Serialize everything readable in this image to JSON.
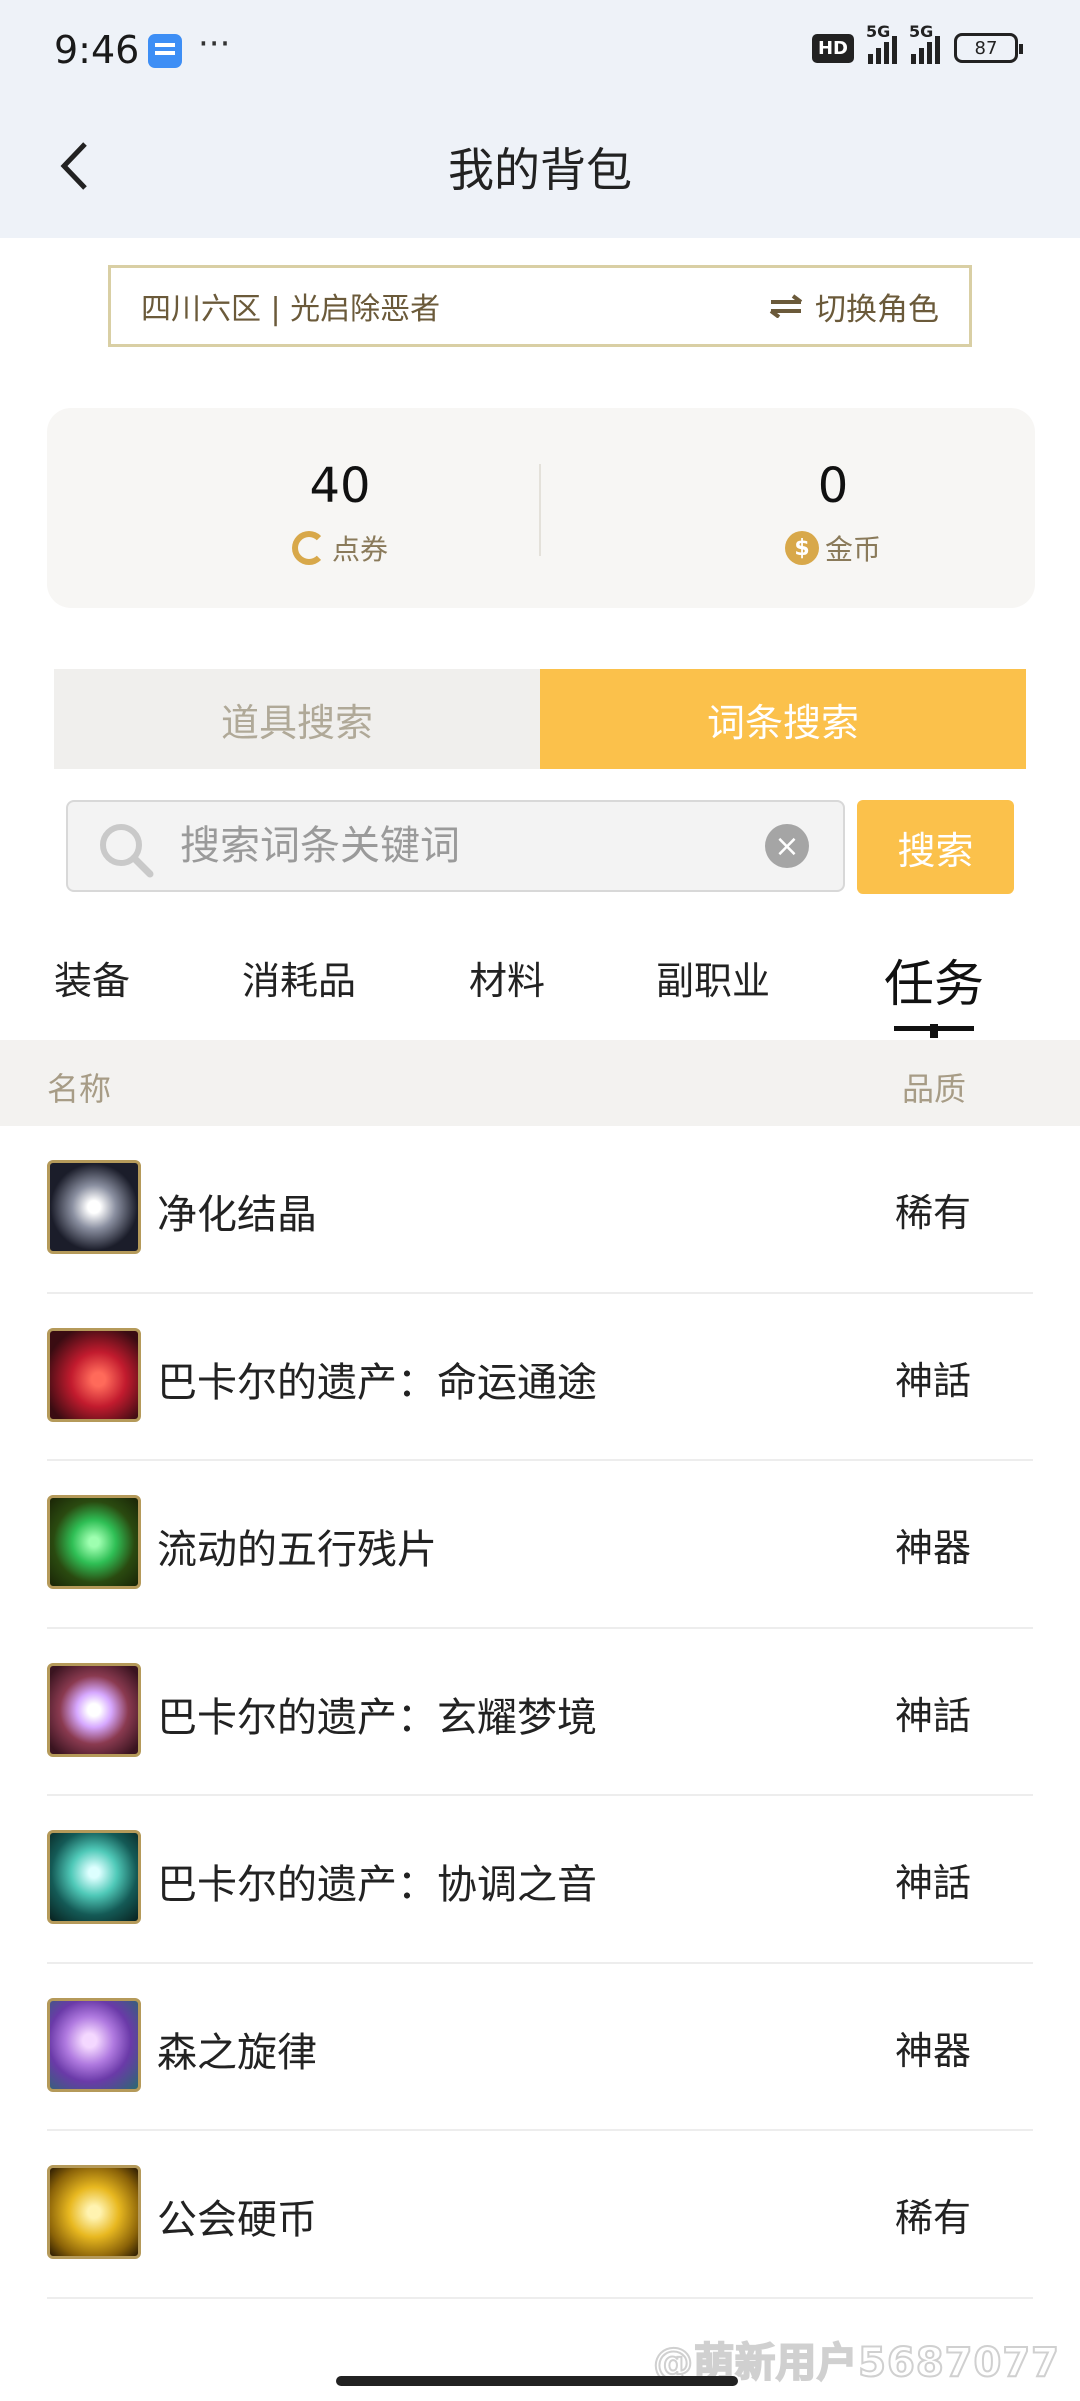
{
  "status_bar": {
    "time": "9:46",
    "dots": "···",
    "hd_label": "HD",
    "signal1_label": "5G",
    "signal2_label": "5G",
    "battery": "87"
  },
  "header": {
    "title": "我的背包"
  },
  "role": {
    "server_role": "四川六区 | 光启除恶者",
    "switch_label": "切换角色"
  },
  "balance": {
    "points_value": "40",
    "points_label": "点券",
    "gold_value": "0",
    "gold_label": "金币"
  },
  "search_tabs": [
    {
      "label": "道具搜索",
      "active": false
    },
    {
      "label": "词条搜索",
      "active": true
    }
  ],
  "search": {
    "placeholder": "搜索词条关键词",
    "button_label": "搜索"
  },
  "categories": [
    {
      "label": "装备",
      "active": false
    },
    {
      "label": "消耗品",
      "active": false
    },
    {
      "label": "材料",
      "active": false
    },
    {
      "label": "副职业",
      "active": false
    },
    {
      "label": "任务",
      "active": true
    }
  ],
  "table": {
    "col_name": "名称",
    "col_quality": "品质",
    "rows": [
      {
        "name": "净化结晶",
        "quality": "稀有"
      },
      {
        "name": "巴卡尔的遗产：命运通途",
        "quality": "神話"
      },
      {
        "name": "流动的五行残片",
        "quality": "神器"
      },
      {
        "name": "巴卡尔的遗产：玄耀梦境",
        "quality": "神話"
      },
      {
        "name": "巴卡尔的遗产：协调之音",
        "quality": "神話"
      },
      {
        "name": "森之旋律",
        "quality": "神器"
      },
      {
        "name": "公会硬币",
        "quality": "稀有"
      }
    ]
  },
  "watermark": "@萌新用户5687077",
  "colors": {
    "accent": "#fbc14b",
    "header_bg": "#eef2f8",
    "gold_text": "#6b5a3a"
  }
}
